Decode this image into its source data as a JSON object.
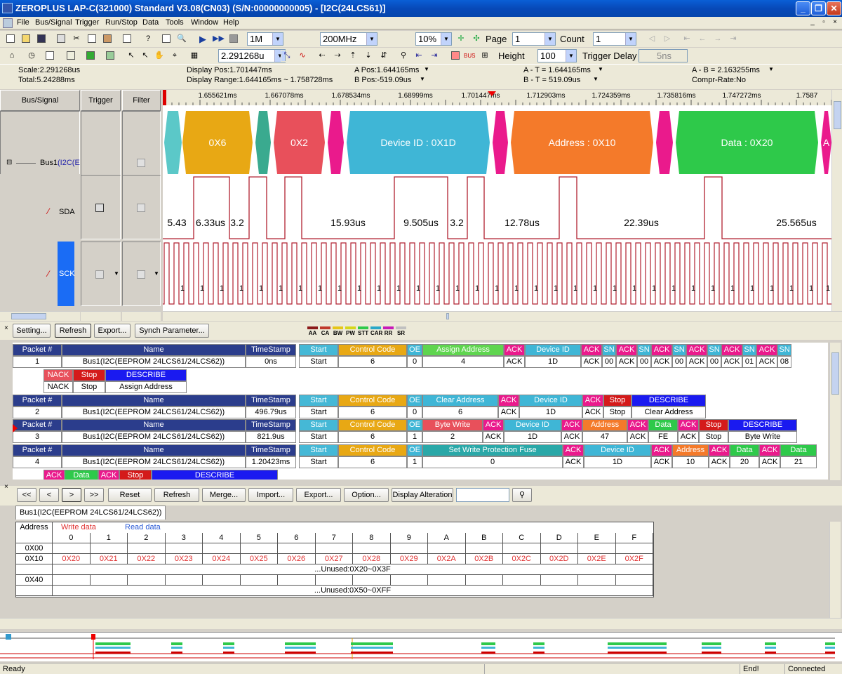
{
  "window": {
    "title": "ZEROPLUS LAP-C(321000) Standard V3.08(CN03) (S/N:00000000005) - [I2C(24LCS61)]",
    "minimize": "_",
    "restore": "❐",
    "close": "✕"
  },
  "menu": {
    "items": [
      "File",
      "Bus/Signal",
      "Trigger",
      "Run/Stop",
      "Data",
      "Tools",
      "Window",
      "Help"
    ]
  },
  "mdi": {
    "minimize": "_",
    "restore": "▫",
    "close": "×"
  },
  "toolbar1": {
    "memory_depth": "1M",
    "sample_rate": "200MHz",
    "zoom": "10%",
    "page_label": "Page",
    "page_value": "1",
    "count_label": "Count",
    "count_value": "1"
  },
  "toolbar2": {
    "scale_value": "2.291268u",
    "height_label": "Height",
    "height_value": "100",
    "trigger_delay_label": "Trigger Delay",
    "trigger_delay_value": "5ns"
  },
  "info": {
    "scale": "Scale:2.291268us",
    "total": "Total:5.24288ms",
    "display_pos": "Display Pos:1.701447ms",
    "display_range": "Display Range:1.644165ms ~ 1.758728ms",
    "a_pos": "A Pos:1.644165ms",
    "b_pos": "B Pos:-519.09us",
    "a_t": "A - T = 1.644165ms",
    "b_t": "B - T = 519.09us",
    "a_b": "A - B = 2.163255ms",
    "compr_rate": "Compr-Rate:No"
  },
  "signal_panel": {
    "col_bus_signal": "Bus/Signal",
    "col_trigger": "Trigger",
    "col_filter": "Filter",
    "bus_label": "Bus1",
    "bus_suffix": "(I2C(EE",
    "sda_label": "SDA",
    "sck_label": "SCK"
  },
  "time_axis": {
    "ticks": [
      "1.655621ms",
      "1.667078ms",
      "1.678534ms",
      "1.68999ms",
      "1.701447ms",
      "1.712903ms",
      "1.724359ms",
      "1.735816ms",
      "1.747272ms",
      "1.7587"
    ]
  },
  "bus_packets": [
    {
      "label": "",
      "color": "#5bc8c8"
    },
    {
      "label": "0X6",
      "color": "#e8a814"
    },
    {
      "label": "",
      "color": "#3aaa8f"
    },
    {
      "label": "0X2",
      "color": "#e8505b"
    },
    {
      "label": "",
      "color": "#ea1a8c"
    },
    {
      "label": "Device ID : 0X1D",
      "color": "#3fb6d6"
    },
    {
      "label": "",
      "color": "#ea1a8c"
    },
    {
      "label": "Address : 0X10",
      "color": "#f47a2a"
    },
    {
      "label": "",
      "color": "#ea1a8c"
    },
    {
      "label": "Data : 0X20",
      "color": "#2ec94a"
    },
    {
      "label": "A",
      "color": "#ea1a8c"
    }
  ],
  "sda_widths": [
    "5.43",
    "6.33us",
    "3.2",
    "15.93us",
    "9.505us",
    "3.2",
    "12.78us",
    "22.39us",
    "25.565us"
  ],
  "sck_one": "1",
  "buttons": {
    "setting": "Setting...",
    "refresh": "Refresh",
    "export": "Export...",
    "synch": "Synch Parameter..."
  },
  "legend": [
    {
      "label": "AA",
      "color": "#8b1a1a"
    },
    {
      "label": "CA",
      "color": "#c0392b"
    },
    {
      "label": "BW",
      "color": "#e6c619"
    },
    {
      "label": "PW",
      "color": "#d6d61a"
    },
    {
      "label": "STT",
      "color": "#2ec94a"
    },
    {
      "label": "CAR",
      "color": "#2aa8c8"
    },
    {
      "label": "RR",
      "color": "#c81ab8"
    },
    {
      "label": "SR",
      "color": "#c0c0c0"
    }
  ],
  "packet_table": {
    "h_packet": "Packet #",
    "h_name": "Name",
    "h_timestamp": "TimeStamp",
    "bus_name": "Bus1(I2C(EEPROM 24LCS61/24LCS62))",
    "rows": [
      {
        "no": "1",
        "ts": "0ns"
      },
      {
        "no": "2",
        "ts": "496.79us"
      },
      {
        "no": "3",
        "ts": "821.9us"
      },
      {
        "no": "4",
        "ts": "1.20423ms"
      }
    ],
    "cells": {
      "start": "Start",
      "control_code": "Control Code",
      "oe": "OE",
      "assign_address": "Assign Address",
      "ack": "ACK",
      "device_id": "Device ID",
      "sn": "SN",
      "nack": "NACK",
      "stop": "Stop",
      "describe": "DESCRIBE",
      "clear_address": "Clear Address",
      "byte_write": "Byte Write",
      "address": "Address",
      "data": "Data",
      "set_wpf": "Set Write Protection Fuse",
      "r1": {
        "cc": "6",
        "oe": "0",
        "aa": "4",
        "did": "1D",
        "sn": [
          "00",
          "00",
          "00",
          "00",
          "01",
          "08"
        ],
        "desc": "Assign Address"
      },
      "r2": {
        "cc": "6",
        "oe": "0",
        "ca": "6",
        "did": "1D",
        "desc": "Clear Address"
      },
      "r3": {
        "cc": "6",
        "oe": "1",
        "bw": "2",
        "did": "1D",
        "addr": "47",
        "data": "FE",
        "desc": "Byte Write"
      },
      "r4": {
        "cc": "6",
        "oe": "1",
        "wpf": "0",
        "did": "1D",
        "addr": "10",
        "d1": "20",
        "d2": "21"
      }
    }
  },
  "mem_toolbar": {
    "first": "<<",
    "prev": "<",
    "next": ">",
    "last": ">>",
    "reset": "Reset",
    "refresh": "Refresh",
    "merge": "Merge...",
    "import": "Import...",
    "export": "Export...",
    "option": "Option...",
    "display_alteration": "Display Alteration"
  },
  "mem_tab": "Bus1(I2C(EEPROM 24LCS61/24LCS62))",
  "mem_grid": {
    "h_address": "Address",
    "write_data": "Write data",
    "read_data": "Read data",
    "cols": [
      "0",
      "1",
      "2",
      "3",
      "4",
      "5",
      "6",
      "7",
      "8",
      "9",
      "A",
      "B",
      "C",
      "D",
      "E",
      "F"
    ],
    "row0": "0X00",
    "row1": "0X10",
    "row1_vals": [
      "0X20",
      "0X21",
      "0X22",
      "0X23",
      "0X24",
      "0X25",
      "0X26",
      "0X27",
      "0X28",
      "0X29",
      "0X2A",
      "0X2B",
      "0X2C",
      "0X2D",
      "0X2E",
      "0X2F"
    ],
    "unused1": "...Unused:0X20~0X3F",
    "row2": "0X40",
    "unused2": "...Unused:0X50~0XFF"
  },
  "status": {
    "ready": "Ready",
    "end": "End!",
    "connected": "Connected"
  }
}
